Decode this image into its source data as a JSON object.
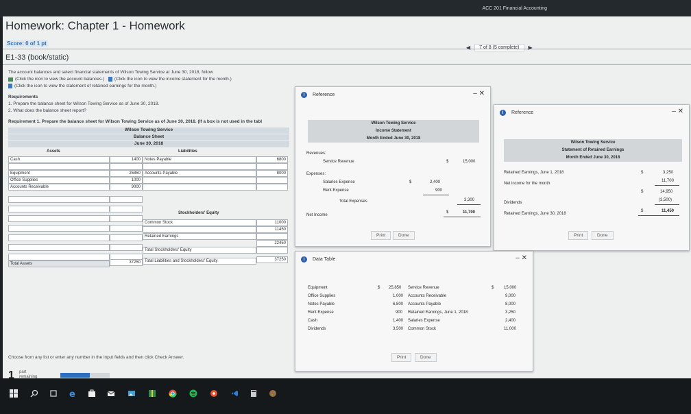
{
  "course_title": "ACC 201 Financial Accounting",
  "hw_title": "Homework: Chapter 1 - Homework",
  "score": "Score: 0 of 1 pt",
  "nav": {
    "position": "7 of 8 (5 complete)",
    "prev": "◀",
    "next": "▶"
  },
  "problem_id": "E1-33 (book/static)",
  "instructions": {
    "line1": "The account balances and select financial statements of Wilson Towing Service at June 30, 2018, follow",
    "line2": "(Click the icon to view the account balances.)",
    "line2b": "(Click the icon to view the income statement for the month.)",
    "line3": "(Click the icon to view the statement of retained earnings for the month.)",
    "req_title": "Requirements",
    "req1": "1.  Prepare the balance sheet for Wilson Towing Service as of June 30, 2018.",
    "req2": "2.  What does the balance sheet report?",
    "req_line": "Requirement 1. Prepare the balance sheet for Wilson Towing Service as of June 30, 2018. (If a box is not used in the tabl"
  },
  "balance_sheet": {
    "company": "Wilson Towing Service",
    "title": "Balance Sheet",
    "date": "June 30, 2018",
    "assets_hdr": "Assets",
    "liab_hdr": "Liabilities",
    "assets": [
      {
        "label": "Cash",
        "value": "1400"
      },
      {
        "label": "Equipment",
        "value": "25850"
      },
      {
        "label": "Office Supplies",
        "value": "1000"
      },
      {
        "label": "Accounts Receivable",
        "value": "9000"
      }
    ],
    "liabilities": [
      {
        "label": "Notes Payable",
        "value": "6800"
      },
      {
        "label": "Accounts Payable",
        "value": "8000"
      }
    ],
    "se_hdr": "Stockholders' Equity",
    "equity": [
      {
        "label": "Common Stock",
        "value": "11000"
      },
      {
        "label": "Retained Earnings",
        "value": "11450"
      },
      {
        "label": "Total Stockholders' Equity",
        "value": "22450"
      },
      {
        "label": "Total Liabilities and Stockholders' Equity",
        "value": "37250"
      }
    ],
    "total_assets_label": "Total Assets",
    "total_assets_value": "37250"
  },
  "hint": "Choose from any list or enter any number in the input fields and then click Check Answer.",
  "part": {
    "num": "1",
    "label1": "part",
    "label2": "remaining"
  },
  "income_popup": {
    "title": "Reference",
    "ctrl": "–  ✕",
    "company": "Wilson Towing Service",
    "stmt": "Income Statement",
    "period": "Month Ended June 30, 2018",
    "revenues": "Revenues:",
    "service_revenue": "Service Revenue",
    "dollar": "$",
    "rev_val": "15,000",
    "expenses": "Expenses:",
    "salaries": "Salaries Expense",
    "salaries_val": "2,400",
    "rent": "Rent Expense",
    "rent_val": "900",
    "total_exp": "Total Expenses",
    "total_exp_val": "3,300",
    "net_income": "Net Income",
    "ni_val": "11,700",
    "print": "Print",
    "done": "Done"
  },
  "re_popup": {
    "title": "Reference",
    "ctrl": "–  ✕",
    "company": "Wilson Towing Service",
    "stmt": "Statement of Retained Earnings",
    "period": "Month Ended June 30, 2018",
    "re_begin": "Retained Earnings, June 1, 2018",
    "re_begin_val": "3,250",
    "ni": "Net income for the month",
    "ni_val": "11,700",
    "sub_val": "14,950",
    "div": "Dividends",
    "div_val": "(3,500)",
    "re_end": "Retained Earnings, June 30, 2018",
    "re_end_val": "11,450",
    "dollar": "$",
    "print": "Print",
    "done": "Done"
  },
  "data_popup": {
    "title": "Data Table",
    "ctrl": "–  ✕",
    "left": [
      {
        "label": "Equipment",
        "value": "25,850"
      },
      {
        "label": "Office Supplies",
        "value": "1,000"
      },
      {
        "label": "Notes Payable",
        "value": "6,800"
      },
      {
        "label": "Rent Expense",
        "value": "900"
      },
      {
        "label": "Cash",
        "value": "1,400"
      },
      {
        "label": "Dividends",
        "value": "3,500"
      }
    ],
    "right": [
      {
        "label": "Service Revenue",
        "value": "15,000"
      },
      {
        "label": "Accounts Receivable",
        "value": "9,000"
      },
      {
        "label": "Accounts Payable",
        "value": "8,000"
      },
      {
        "label": "Retained Earnings, June 1, 2018",
        "value": "3,250"
      },
      {
        "label": "Salaries Expense",
        "value": "2,400"
      },
      {
        "label": "Common Stock",
        "value": "11,000"
      }
    ],
    "dollar": "$",
    "print": "Print",
    "done": "Done"
  },
  "taskbar_icons": [
    "windows-icon",
    "search-icon",
    "task-view-icon",
    "edge-icon",
    "store-icon",
    "mail-icon",
    "photos-icon",
    "maps-icon",
    "chrome-icon",
    "spotify-icon",
    "media-icon",
    "vscode-icon",
    "calculator-icon",
    "paint-icon"
  ]
}
